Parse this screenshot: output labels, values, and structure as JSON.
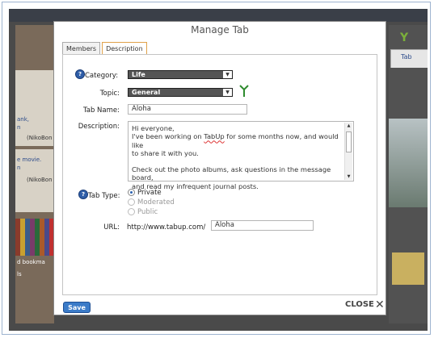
{
  "background": {
    "left_panel_texts": [
      "ank,",
      "n",
      "(NikoBon",
      "e movie.",
      "n",
      "(NikoBon",
      "d bookma",
      "ls"
    ],
    "right_panel_tab": "Tab"
  },
  "dialog": {
    "title": "Manage Tab",
    "tabs": [
      {
        "label": "Members",
        "active": false
      },
      {
        "label": "Description",
        "active": true
      }
    ],
    "form": {
      "category_label": "Category:",
      "category_value": "Life",
      "topic_label": "Topic:",
      "topic_value": "General",
      "tabname_label": "Tab Name:",
      "tabname_value": "Aloha",
      "description_label": "Description:",
      "description_lines": [
        "Hi everyone,",
        "I've been working on TabUp for some months now, and would like",
        "to share it with you.",
        "",
        "Check out the photo albums, ask questions in the message board,",
        "and read my infrequent journal posts."
      ],
      "tabtype_label": "Tab Type:",
      "tabtype_options": [
        "Private",
        "Moderated",
        "Public"
      ],
      "tabtype_selected": "Private",
      "url_label": "URL:",
      "url_prefix": "http://www.tabup.com/",
      "url_value": "Aloha"
    },
    "save_label": "Save",
    "close_label": "CLOSE"
  },
  "colors": {
    "accent_blue": "#3b7bc8",
    "active_tab_border": "#e0a24a",
    "tree_icon_green": "#2e8b2e"
  }
}
